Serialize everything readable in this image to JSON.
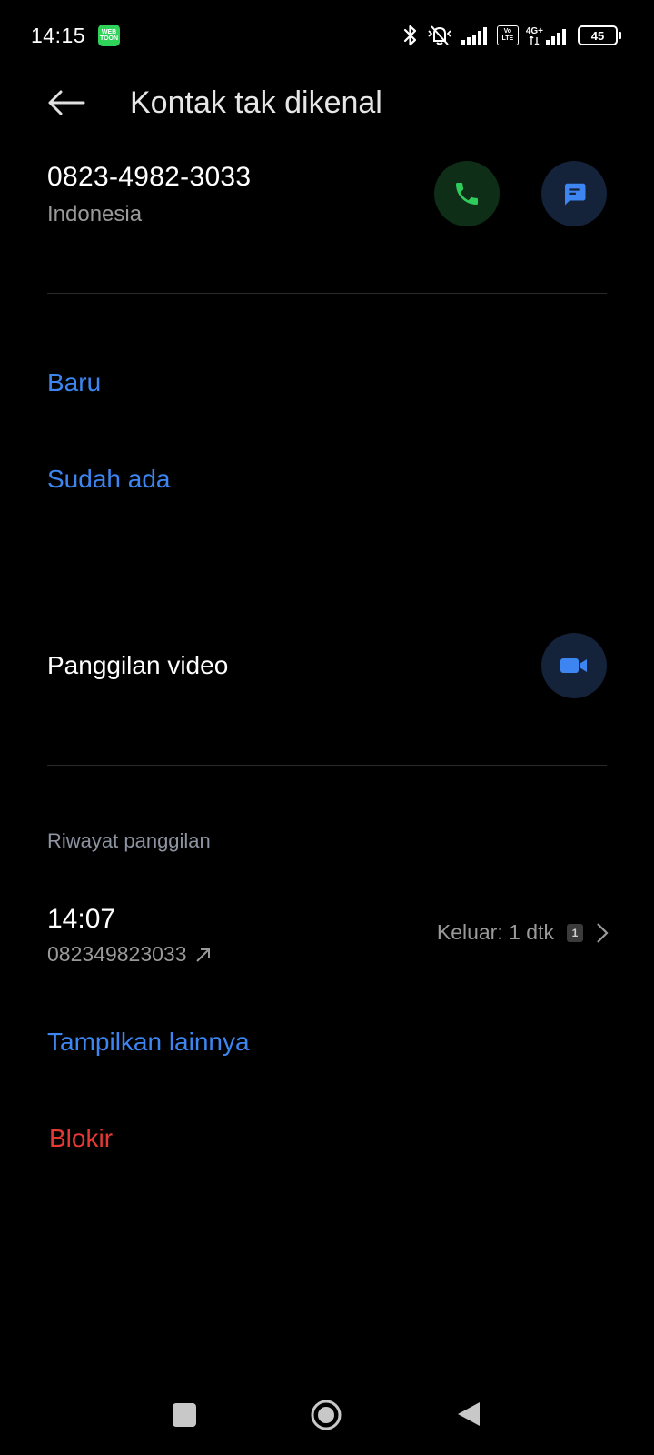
{
  "status_bar": {
    "time": "14:15",
    "badge_text": "WEB TOON",
    "network_type": "4G+",
    "volte_top": "Vo",
    "volte_bottom": "LTE",
    "battery_level": "45"
  },
  "header": {
    "title": "Kontak tak dikenal"
  },
  "contact": {
    "phone_number": "0823-4982-3033",
    "country": "Indonesia"
  },
  "actions": {
    "new_contact_label": "Baru",
    "existing_contact_label": "Sudah ada",
    "video_call_label": "Panggilan video"
  },
  "call_history": {
    "section_title": "Riwayat panggilan",
    "entries": [
      {
        "time": "14:07",
        "number": "082349823033",
        "detail": "Keluar: 1 dtk",
        "sim": "1"
      }
    ],
    "show_more_label": "Tampilkan lainnya"
  },
  "block_label": "Blokir",
  "colors": {
    "background": "#000000",
    "accent_blue": "#3d86f2",
    "call_green": "#2ecc5a",
    "danger_red": "#e53935",
    "secondary_text": "#9a9a9a"
  },
  "icons": {
    "back": "arrow-left-icon",
    "call": "phone-icon",
    "message": "message-icon",
    "video": "video-camera-icon",
    "outgoing": "outgoing-call-arrow-icon",
    "chevron": "chevron-right-icon"
  }
}
